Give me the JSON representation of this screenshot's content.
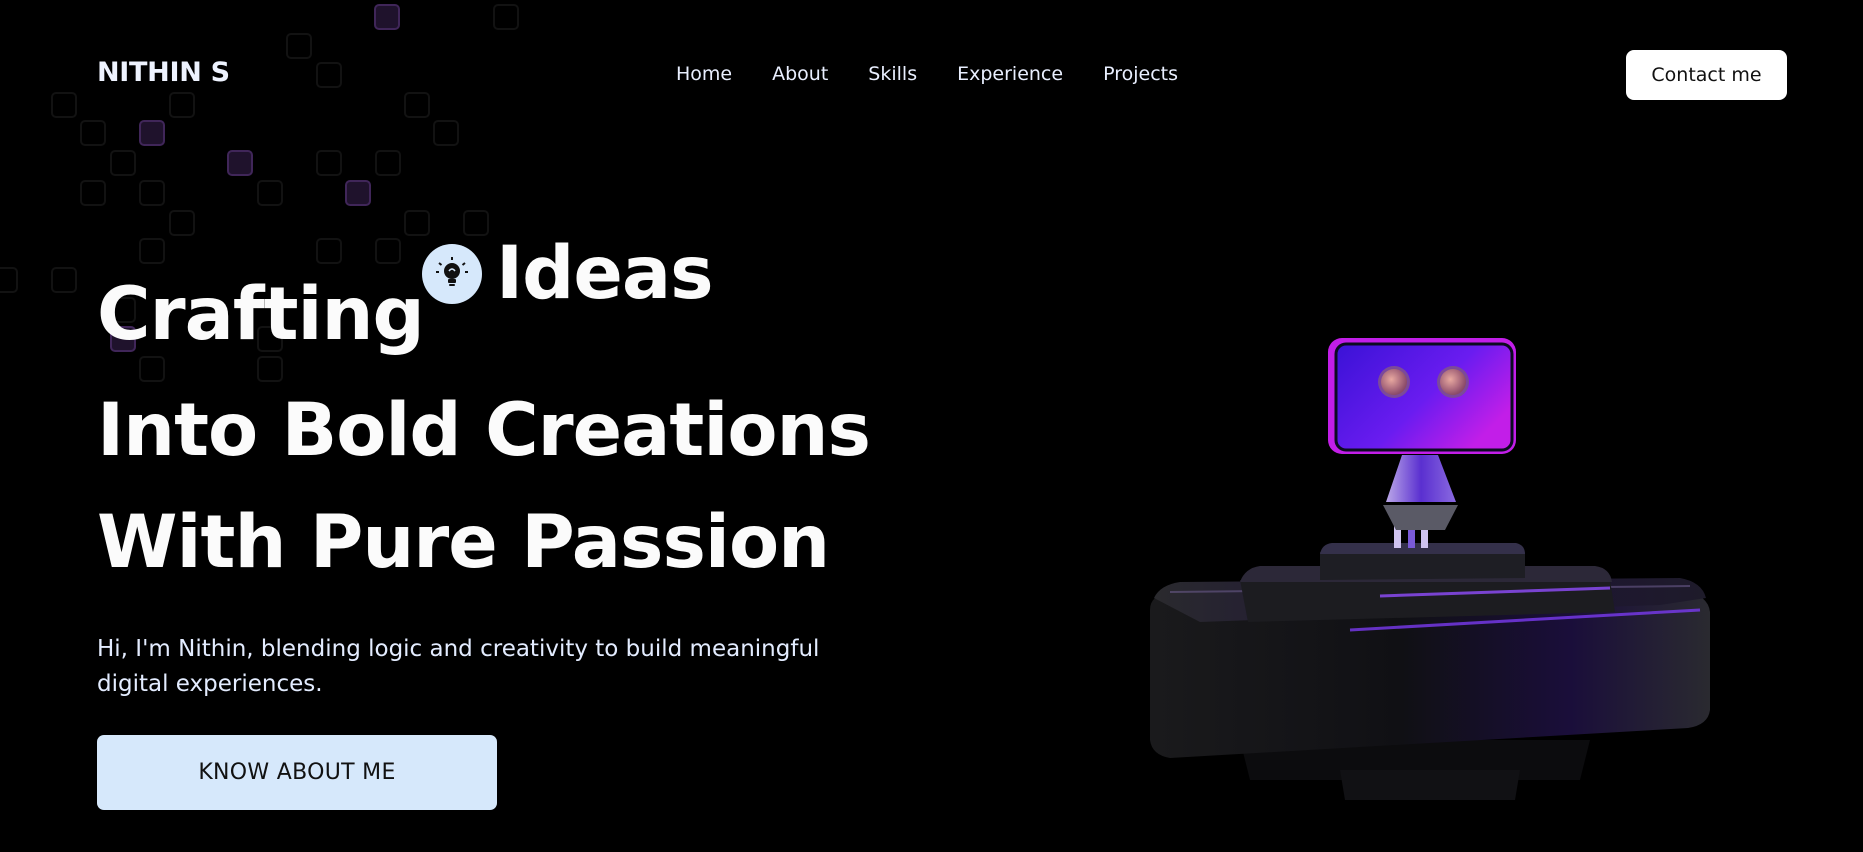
{
  "header": {
    "logo": "NITHIN S",
    "nav": [
      "Home",
      "About",
      "Skills",
      "Experience",
      "Projects"
    ],
    "contact_label": "Contact me"
  },
  "hero": {
    "line1": "Crafting",
    "rotating_word": "Ideas",
    "rotating_icon": "lightbulb-icon",
    "line2": "Into Bold Creations",
    "line3": "With Pure Passion",
    "subtitle": "Hi, I'm Nithin, blending logic and creativity to build meaningful digital experiences.",
    "cta_label": "KNOW ABOUT ME"
  },
  "colors": {
    "background": "#000000",
    "accent_light": "#d6e8fb",
    "robot_purple": "#6a1cf0",
    "robot_magenta": "#c21ee8"
  }
}
